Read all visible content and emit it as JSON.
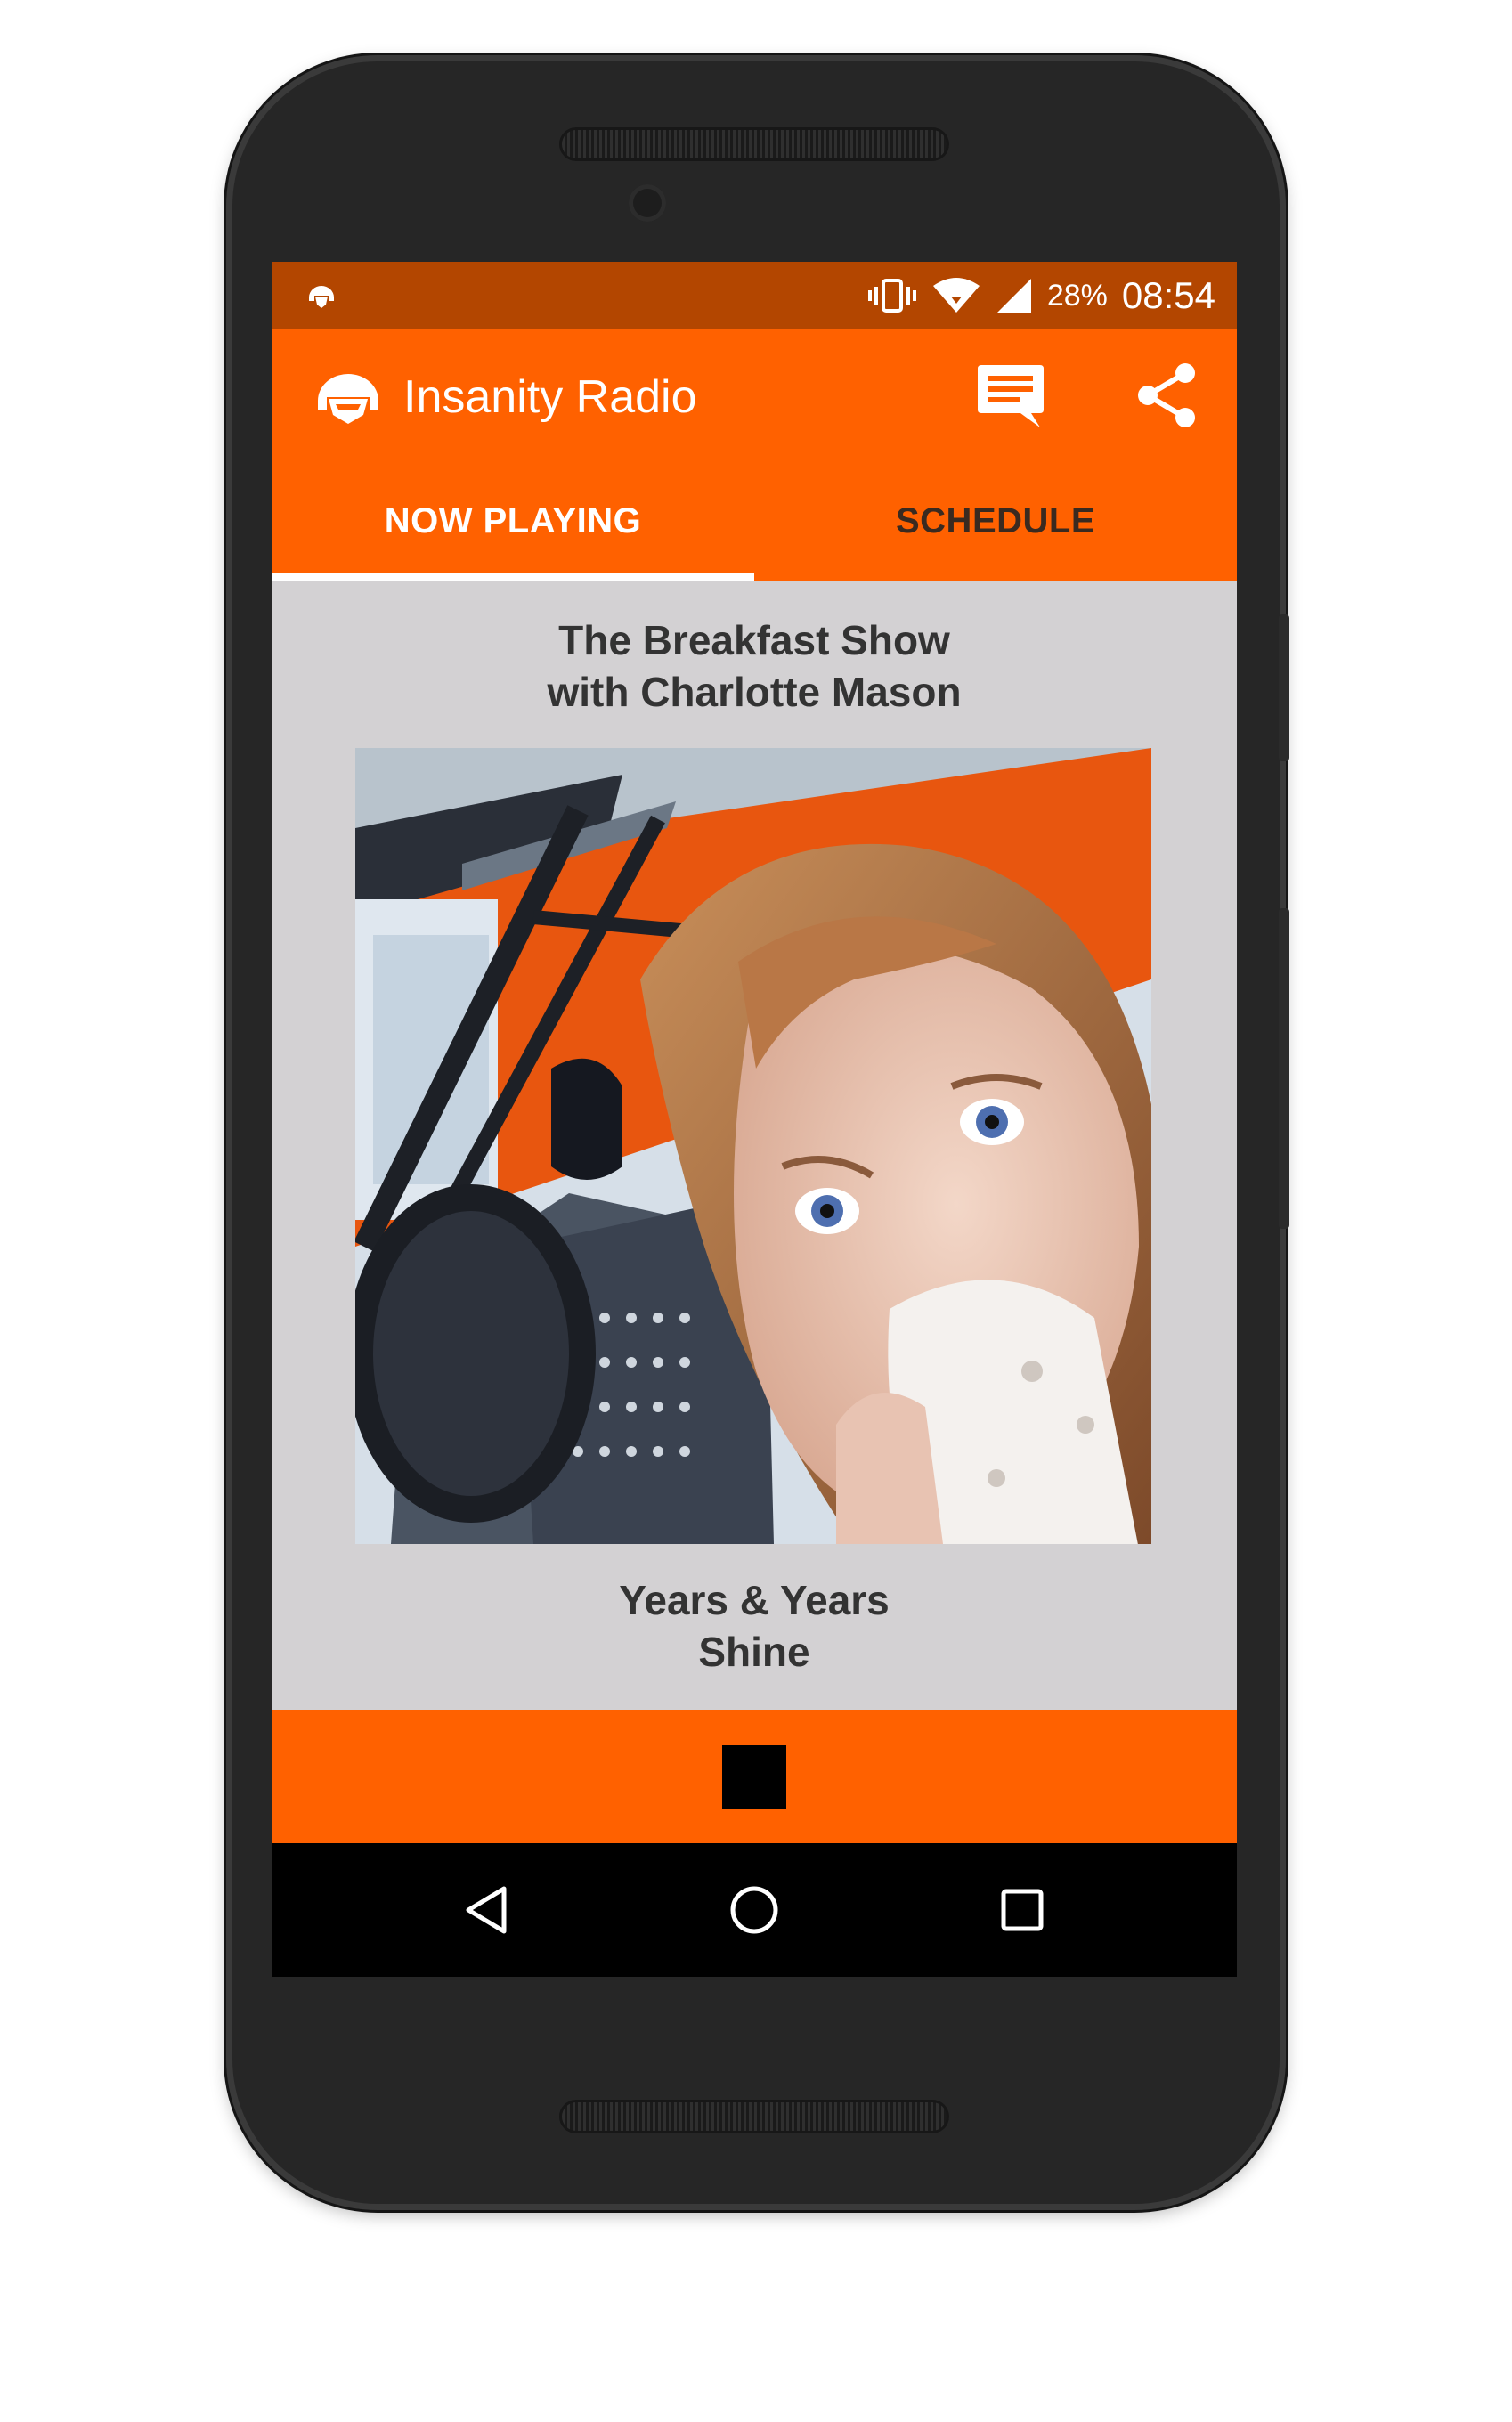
{
  "status_bar": {
    "battery_percent": "28%",
    "time": "08:54",
    "icons": [
      "app-notification-icon",
      "vibrate-icon",
      "wifi-icon",
      "cell-signal-icon"
    ]
  },
  "app_bar": {
    "title": "Insanity Radio",
    "actions": [
      "message-icon",
      "share-icon"
    ]
  },
  "tabs": [
    {
      "label": "NOW PLAYING",
      "selected": true
    },
    {
      "label": "SCHEDULE",
      "selected": false
    }
  ],
  "now_playing": {
    "show_line1": "The Breakfast Show",
    "show_line2": "with Charlotte Mason",
    "artist": "Years & Years",
    "song": "Shine"
  },
  "player": {
    "control": "stop-icon"
  },
  "nav": {
    "buttons": [
      "back-icon",
      "home-icon",
      "recents-icon"
    ]
  },
  "colors": {
    "accent": "#ff6100",
    "status_bar": "#b34600",
    "content_bg": "#d3d1d3",
    "text_dark": "#333333"
  }
}
